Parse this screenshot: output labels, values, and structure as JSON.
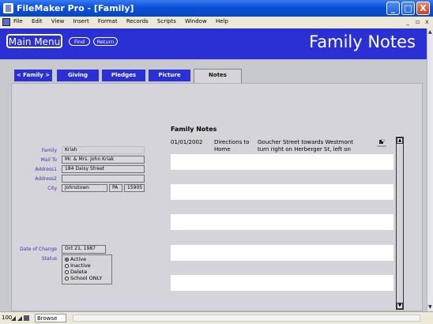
{
  "window": {
    "title": "FileMaker Pro - [Family]",
    "controls": {
      "minimize": "_",
      "maximize": "□",
      "close": "X"
    }
  },
  "menu": {
    "items": [
      "File",
      "Edit",
      "View",
      "Insert",
      "Format",
      "Records",
      "Scripts",
      "Window",
      "Help"
    ],
    "mdi_controls": {
      "minimize": "_",
      "restore": "▫",
      "close": "x"
    }
  },
  "header": {
    "main_menu": "Main Menu",
    "find": "Find",
    "return": "Return",
    "title": "Family Notes"
  },
  "tabs": [
    {
      "label": "< Family >"
    },
    {
      "label": "Giving"
    },
    {
      "label": "Pledges"
    },
    {
      "label": "Picture"
    },
    {
      "label": "Notes",
      "active": true
    }
  ],
  "form": {
    "family_label": "Family",
    "family_value": "Kriah",
    "mailto_label": "Mail To",
    "mailto_value": "Mr. & Mrs. John Kriak",
    "address1_label": "Address1",
    "address1_value": "184 Daisy Street",
    "address2_label": "Address2",
    "address2_value": "",
    "city_label": "City",
    "city_value": "Johnstown",
    "state_value": "PA",
    "zip_value": "15905",
    "date_label": "Date of Change",
    "date_value": "Oct 21, 1987",
    "status_label": "Status",
    "status_options": [
      {
        "label": "Active",
        "selected": true
      },
      {
        "label": "Inactive",
        "selected": false
      },
      {
        "label": "Delete",
        "selected": false
      },
      {
        "label": "School ONLY",
        "selected": false
      }
    ]
  },
  "notes": {
    "heading": "Family Notes",
    "rows": [
      {
        "date": "01/01/2002",
        "subject_line1": "Directions to",
        "subject_line2": "Home",
        "text_line1": "Goucher Street towards Westmont",
        "text_line2": "turn right on Herberger St, left on"
      }
    ]
  },
  "status_bar": {
    "zoom": "100",
    "mode": "Browse"
  },
  "colors": {
    "header_blue": "#2b30d4",
    "label_blue": "#3a3aa8",
    "panel_gray": "#d4d4da",
    "background_gray": "#c8c9cf"
  }
}
